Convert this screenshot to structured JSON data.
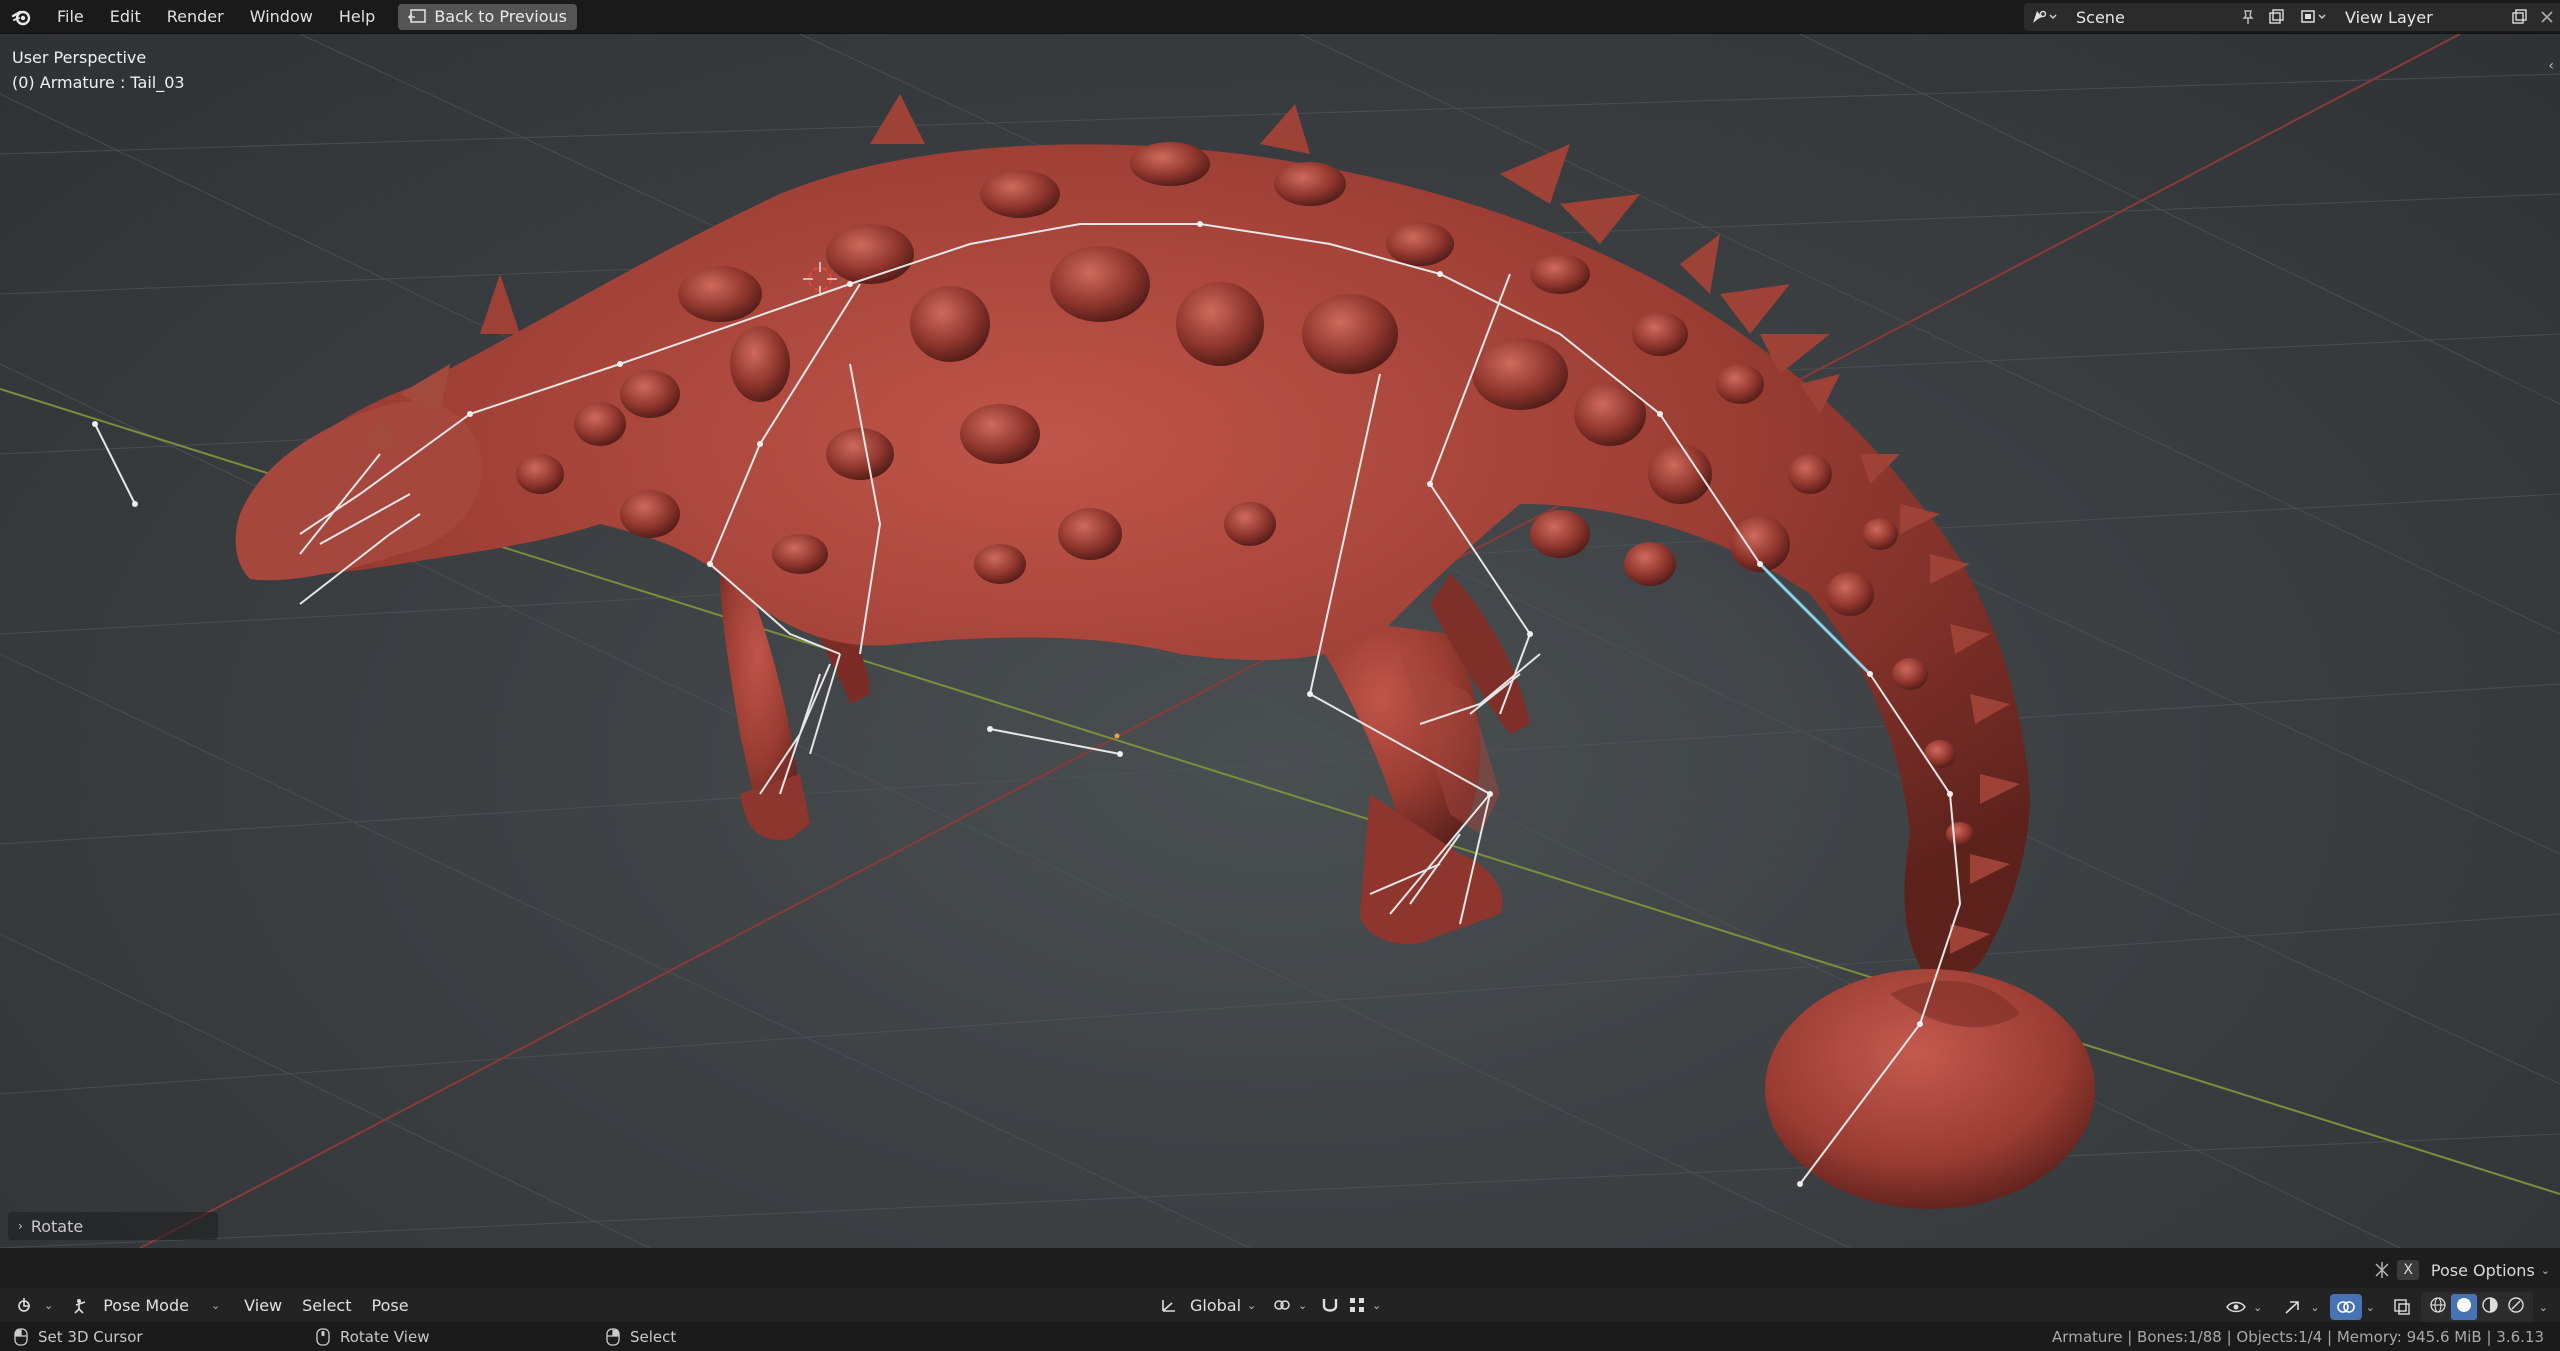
{
  "menu": [
    "File",
    "Edit",
    "Render",
    "Window",
    "Help"
  ],
  "back_button": "Back to Previous",
  "scene": {
    "label": "Scene"
  },
  "view_layer": {
    "label": "View Layer"
  },
  "viewport": {
    "perspective": "User Perspective",
    "active_object": "(0) Armature : Tail_03",
    "last_operator": "Rotate"
  },
  "pose_options": "Pose Options",
  "header": {
    "mode": "Pose Mode",
    "menus": [
      "View",
      "Select",
      "Pose"
    ],
    "transform_orientation": "Global"
  },
  "status": {
    "items": [
      {
        "icon": "mouse-left-icon",
        "label": "Set 3D Cursor"
      },
      {
        "icon": "mouse-middle-icon",
        "label": "Rotate View"
      },
      {
        "icon": "mouse-right-icon",
        "label": "Select"
      }
    ],
    "stats": "Armature | Bones:1/88 | Objects:1/4 | Memory: 945.6 MiB | 3.6.13"
  },
  "colors": {
    "creature": "#9b3d33",
    "accent": "#4772b3",
    "x_axis": "#8a3a3a",
    "y_axis": "#7a8f3c"
  }
}
